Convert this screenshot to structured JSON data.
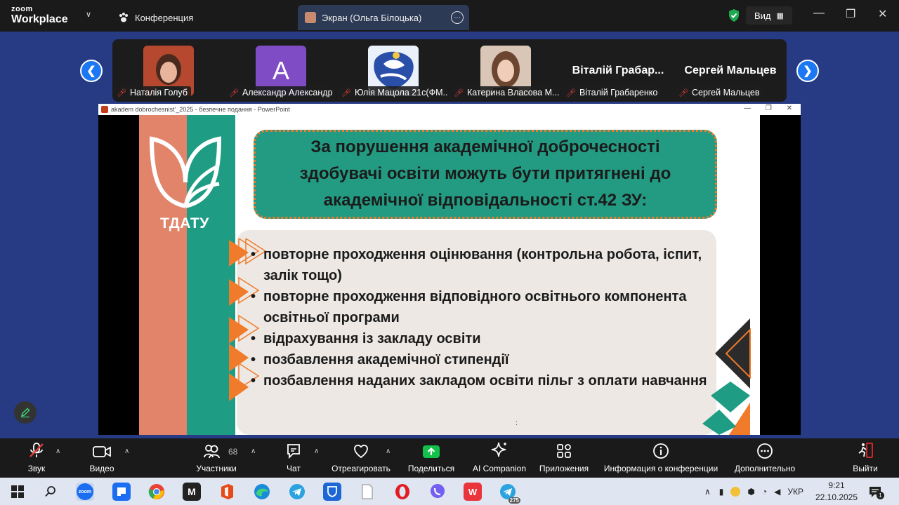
{
  "app": {
    "logo_line1": "zoom",
    "logo_line2": "Workplace",
    "tabs": [
      {
        "label": "Конференция"
      },
      {
        "label": "Экран (Ольга Білоцька)"
      }
    ],
    "view_label": "Вид"
  },
  "gallery": {
    "participants": [
      {
        "name": "Наталія Голуб",
        "muted": true,
        "display": "photo"
      },
      {
        "name": "Александр Александр",
        "muted": true,
        "display": "letter",
        "letter": "A"
      },
      {
        "name": "Юлія Мацола 21с(ФМ...",
        "muted": true,
        "display": "image"
      },
      {
        "name": "Катерина Власова М...",
        "muted": true,
        "display": "photo"
      },
      {
        "name": "Віталій Грабаренко",
        "muted": true,
        "display": "name",
        "big_name": "Віталій  Грабар..."
      },
      {
        "name": "Сергей Мальцев",
        "muted": true,
        "display": "name",
        "big_name": "Сергей Мальцев"
      }
    ]
  },
  "share": {
    "window_title": "akadem dobrochesnist'_2025  -  безпечне подання - PowerPoint",
    "slide": {
      "logo_text": "ТДАТУ",
      "heading_lines": [
        "За порушення академічної доброчесності",
        "здобувачі освіти можуть бути притягнені до",
        "академічної відповідальності ст.42 ЗУ:"
      ],
      "items": [
        {
          "bullet": "•",
          "text": "повторне проходження оцінювання (контрольна робота, іспит, залік тощо)"
        },
        {
          "bullet": "•",
          "text": "повторне проходження відповідного освітнього компонента освітньої програми"
        },
        {
          "bullet": "•",
          "text": "відрахування із закладу освіти"
        },
        {
          "bullet": "•",
          "text": "позбавлення академічної стипендії"
        },
        {
          "bullet": "•",
          "text": "позбавлення наданих закладом освіти пільг з оплати навчання"
        }
      ],
      "footer_mark": ":"
    }
  },
  "toolbar": {
    "mic": "Звук",
    "video": "Видео",
    "participants": "Участники",
    "participants_count": "68",
    "chat": "Чат",
    "react": "Отреагировать",
    "share": "Поделиться",
    "ai": "AI Companion",
    "apps": "Приложения",
    "info": "Информация о конференции",
    "more": "Дополнительно",
    "leave": "Выйти"
  },
  "taskbar": {
    "zoom_icon_text": "zoom",
    "telegram_badge": "275",
    "language": "УКР",
    "time": "9:21",
    "date": "22.10.2025",
    "notification_count": "1"
  },
  "colors": {
    "stage_blue": "#273a84",
    "accent_blue": "#1b77f2",
    "share_green": "#12c04a",
    "leave_red": "#e02828",
    "slide_teal": "#1e9d84",
    "slide_coral": "#e2846a",
    "slide_orange": "#f07b2a"
  }
}
